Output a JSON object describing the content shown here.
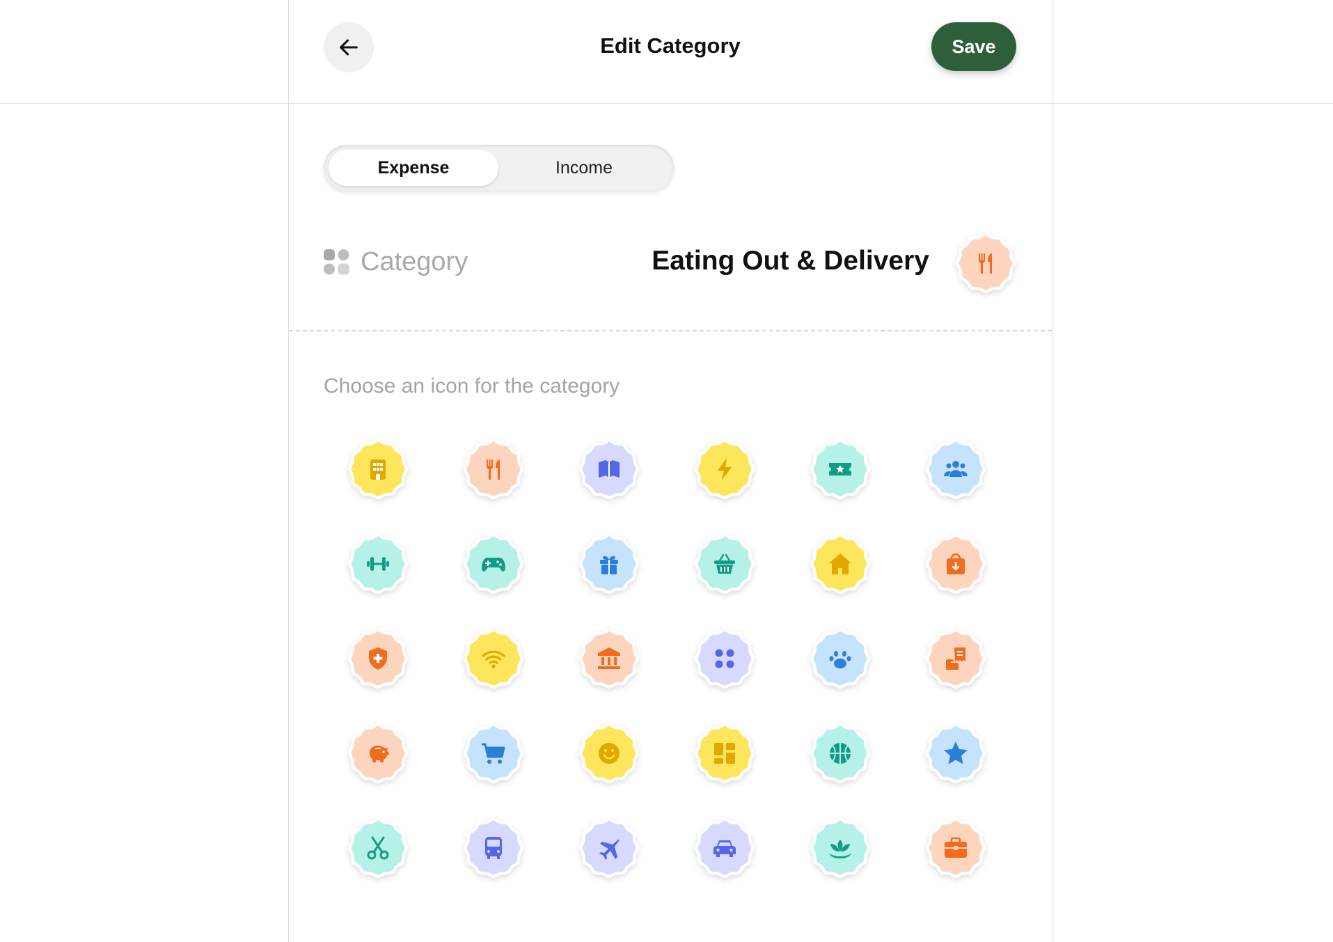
{
  "header": {
    "title": "Edit Category",
    "save_label": "Save"
  },
  "type_toggle": {
    "options": [
      "Expense",
      "Income"
    ],
    "selected": "Expense"
  },
  "category": {
    "label": "Category",
    "name": "Eating Out & Delivery",
    "icon": "utensils-icon",
    "icon_bg": "#fdd5bf",
    "icon_fg": "#f26c1d"
  },
  "icon_picker": {
    "hint": "Choose an icon for the category",
    "icons": [
      {
        "name": "building-icon",
        "bg": "#fde55c",
        "fg": "#e0a800"
      },
      {
        "name": "utensils-icon",
        "bg": "#fdd5bf",
        "fg": "#f26c1d"
      },
      {
        "name": "book-icon",
        "bg": "#d7dafe",
        "fg": "#5566e6"
      },
      {
        "name": "lightning-icon",
        "bg": "#fde55c",
        "fg": "#e0a800"
      },
      {
        "name": "ticket-icon",
        "bg": "#b5f1e7",
        "fg": "#129c86"
      },
      {
        "name": "people-icon",
        "bg": "#c6e3fd",
        "fg": "#2b7fd8"
      },
      {
        "name": "dumbbell-icon",
        "bg": "#b5f1e7",
        "fg": "#129c86"
      },
      {
        "name": "gamepad-icon",
        "bg": "#b5f1e7",
        "fg": "#129c86"
      },
      {
        "name": "gift-icon",
        "bg": "#c6e3fd",
        "fg": "#2b7fd8"
      },
      {
        "name": "basket-icon",
        "bg": "#b5f1e7",
        "fg": "#129c86"
      },
      {
        "name": "house-icon",
        "bg": "#fde55c",
        "fg": "#e0a800"
      },
      {
        "name": "shopping-bag-icon",
        "bg": "#fdd5bf",
        "fg": "#f26c1d"
      },
      {
        "name": "medical-shield-icon",
        "bg": "#fdd5bf",
        "fg": "#f26c1d"
      },
      {
        "name": "wifi-icon",
        "bg": "#fde55c",
        "fg": "#e0a800"
      },
      {
        "name": "bank-icon",
        "bg": "#fdd5bf",
        "fg": "#f26c1d"
      },
      {
        "name": "grid-dots-icon",
        "bg": "#d7dafe",
        "fg": "#5566e6"
      },
      {
        "name": "paw-icon",
        "bg": "#c6e3fd",
        "fg": "#2b7fd8"
      },
      {
        "name": "receipt-hand-icon",
        "bg": "#fdd5bf",
        "fg": "#f26c1d"
      },
      {
        "name": "piggy-bank-icon",
        "bg": "#fdd5bf",
        "fg": "#f26c1d"
      },
      {
        "name": "cart-icon",
        "bg": "#c6e3fd",
        "fg": "#2b7fd8"
      },
      {
        "name": "smiley-icon",
        "bg": "#fde55c",
        "fg": "#e0a800"
      },
      {
        "name": "dashboard-icon",
        "bg": "#fde55c",
        "fg": "#e0a800"
      },
      {
        "name": "basketball-icon",
        "bg": "#b5f1e7",
        "fg": "#129c86"
      },
      {
        "name": "star-icon",
        "bg": "#c6e3fd",
        "fg": "#2b7fd8"
      },
      {
        "name": "scissors-icon",
        "bg": "#b5f1e7",
        "fg": "#129c86"
      },
      {
        "name": "bus-icon",
        "bg": "#d7dafe",
        "fg": "#5566e6"
      },
      {
        "name": "airplane-icon",
        "bg": "#d7dafe",
        "fg": "#5566e6"
      },
      {
        "name": "car-icon",
        "bg": "#d7dafe",
        "fg": "#5566e6"
      },
      {
        "name": "lotus-icon",
        "bg": "#b5f1e7",
        "fg": "#129c86"
      },
      {
        "name": "briefcase-icon",
        "bg": "#fdd5bf",
        "fg": "#f26c1d"
      }
    ]
  }
}
